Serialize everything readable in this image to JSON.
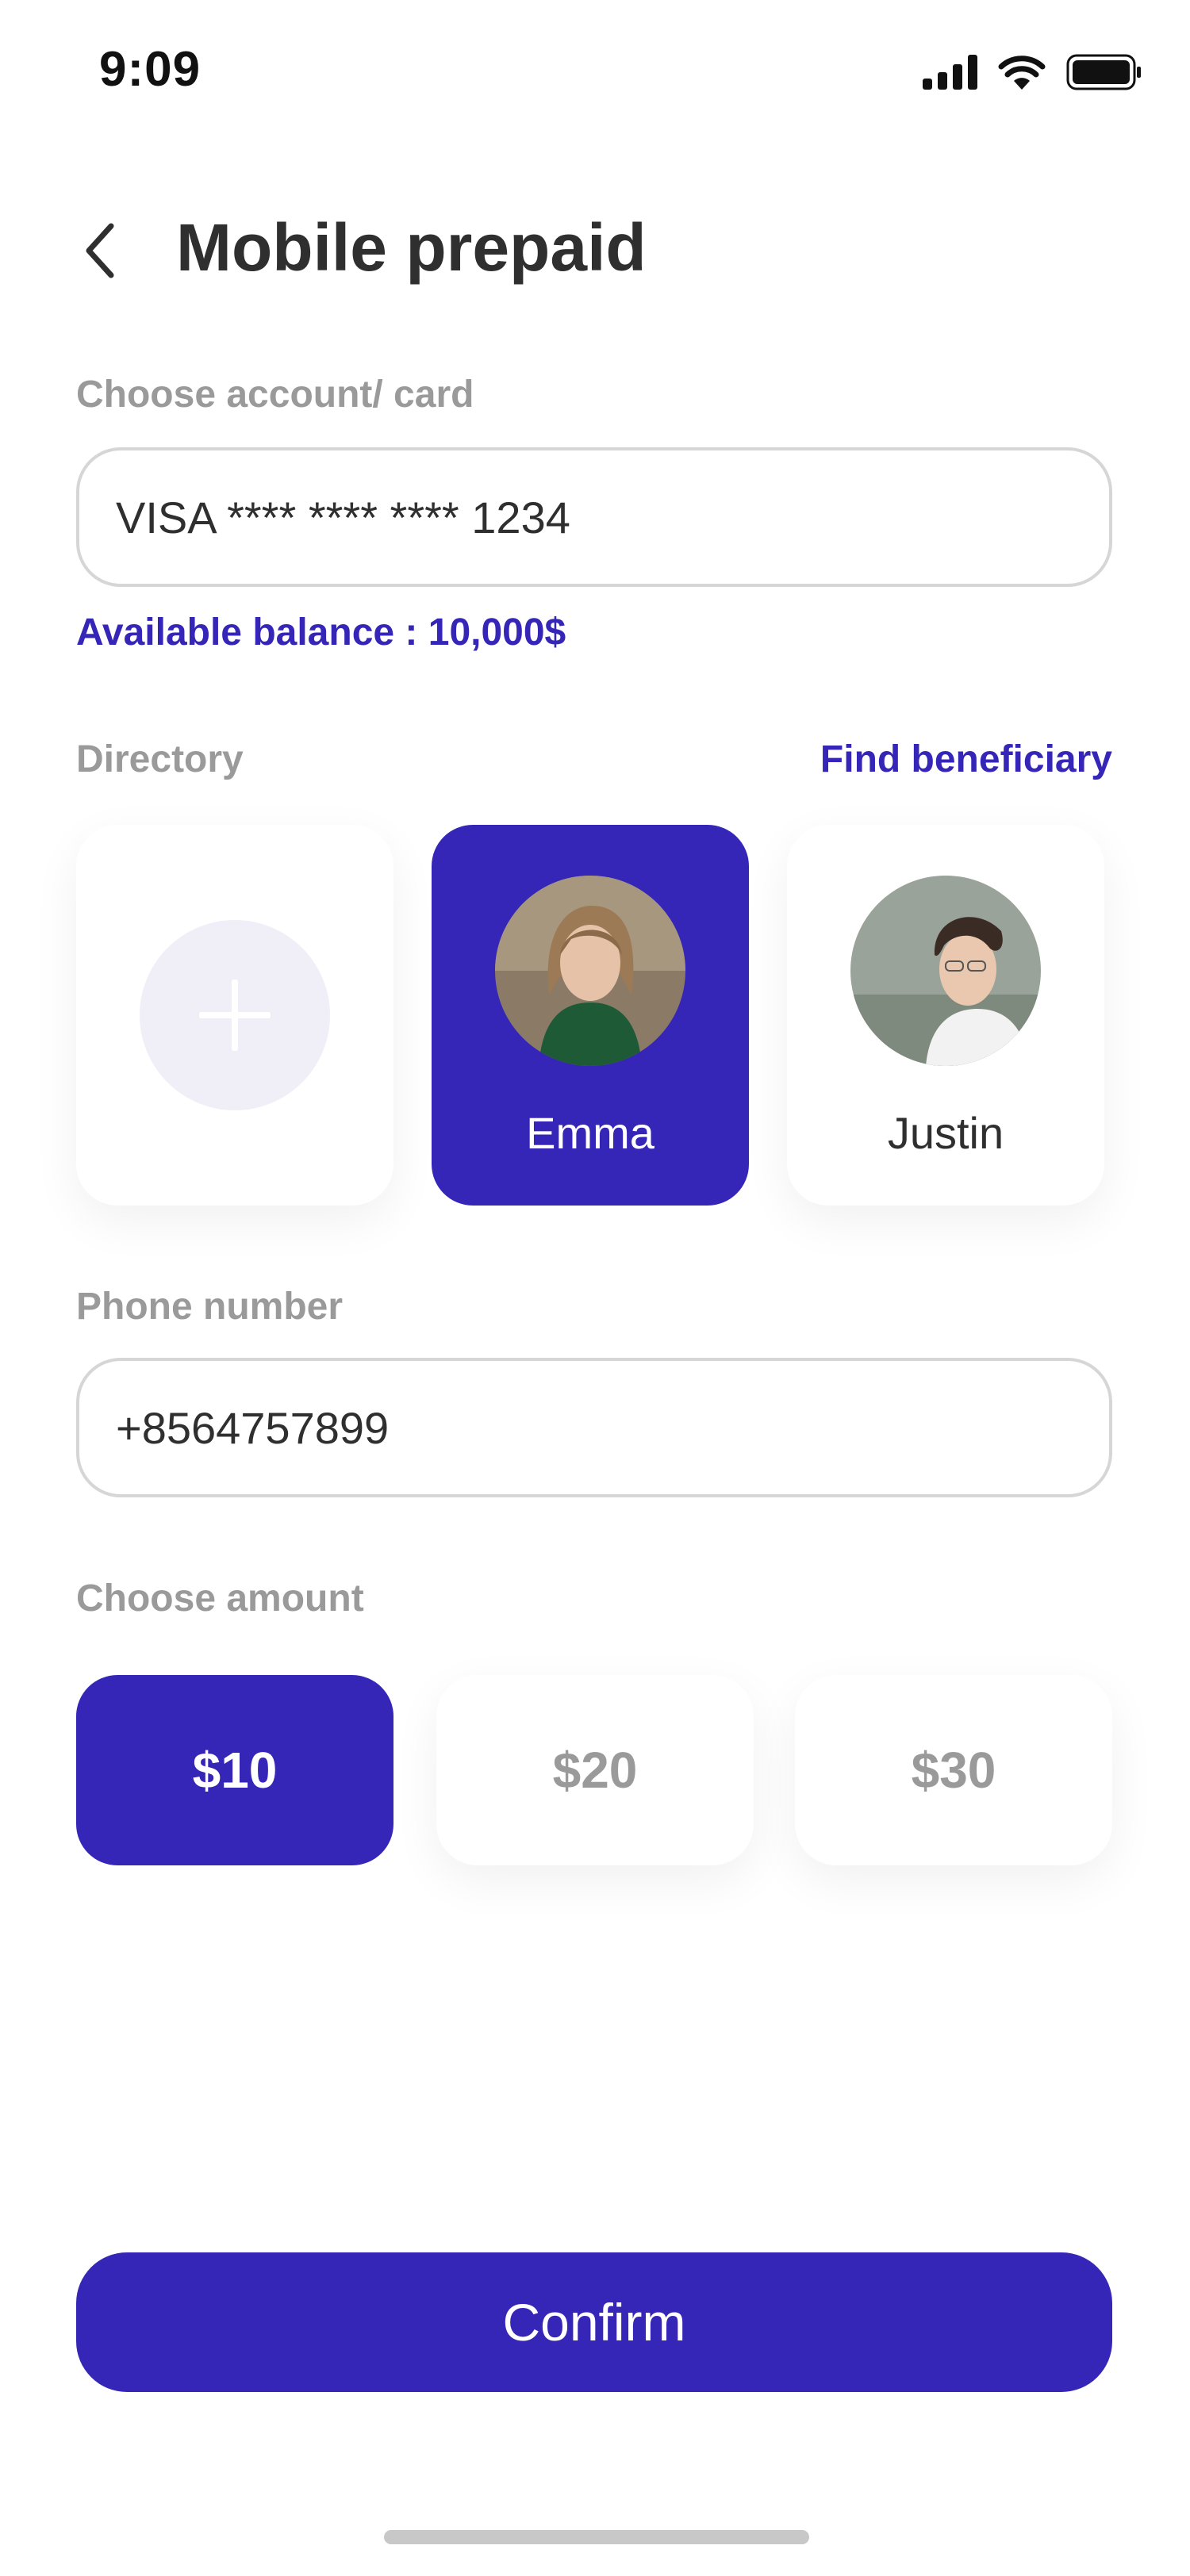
{
  "status_bar": {
    "time": "9:09"
  },
  "header": {
    "title": "Mobile prepaid",
    "back_icon": "chevron-left-icon"
  },
  "account": {
    "label": "Choose account/ card",
    "value": "VISA **** **** **** 1234",
    "balance": "Available balance : 10,000$"
  },
  "directory": {
    "label": "Directory",
    "link": "Find beneficiary",
    "add_icon": "plus-icon",
    "contacts": [
      {
        "name": "Emma",
        "selected": true
      },
      {
        "name": "Justin",
        "selected": false
      }
    ]
  },
  "phone": {
    "label": "Phone number",
    "value": "+8564757899"
  },
  "amount": {
    "label": "Choose amount",
    "options": [
      {
        "label": "$10",
        "selected": true
      },
      {
        "label": "$20",
        "selected": false
      },
      {
        "label": "$30",
        "selected": false
      }
    ]
  },
  "confirm_label": "Confirm",
  "colors": {
    "accent": "#3526b8",
    "muted": "#9a9a9a",
    "text": "#2f2f2f"
  }
}
